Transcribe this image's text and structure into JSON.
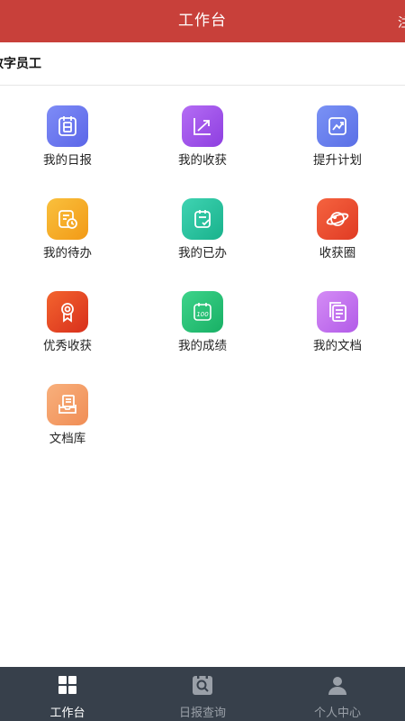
{
  "header": {
    "title": "工作台",
    "right_text": "注"
  },
  "user": {
    "name": "数字员工"
  },
  "grid": {
    "items": [
      {
        "label": "我的日报",
        "icon": "calendar-icon"
      },
      {
        "label": "我的收获",
        "icon": "chart-icon"
      },
      {
        "label": "提升计划",
        "icon": "trend-up-icon"
      },
      {
        "label": "我的待办",
        "icon": "todo-clock-icon"
      },
      {
        "label": "我的已办",
        "icon": "done-check-icon"
      },
      {
        "label": "收获圈",
        "icon": "planet-icon"
      },
      {
        "label": "优秀收获",
        "icon": "award-icon"
      },
      {
        "label": "我的成绩",
        "icon": "score-icon"
      },
      {
        "label": "我的文档",
        "icon": "documents-icon"
      },
      {
        "label": "文档库",
        "icon": "archive-icon"
      }
    ]
  },
  "tabbar": {
    "tabs": [
      {
        "label": "工作台",
        "icon": "grid-icon",
        "active": true
      },
      {
        "label": "日报查询",
        "icon": "report-search-icon",
        "active": false
      },
      {
        "label": "个人中心",
        "icon": "person-icon",
        "active": false
      }
    ]
  },
  "colors": {
    "header": "#c8403a",
    "tabbar": "#37404b",
    "tab_active": "#ffffff",
    "tab_inactive": "#9aa0a8"
  }
}
